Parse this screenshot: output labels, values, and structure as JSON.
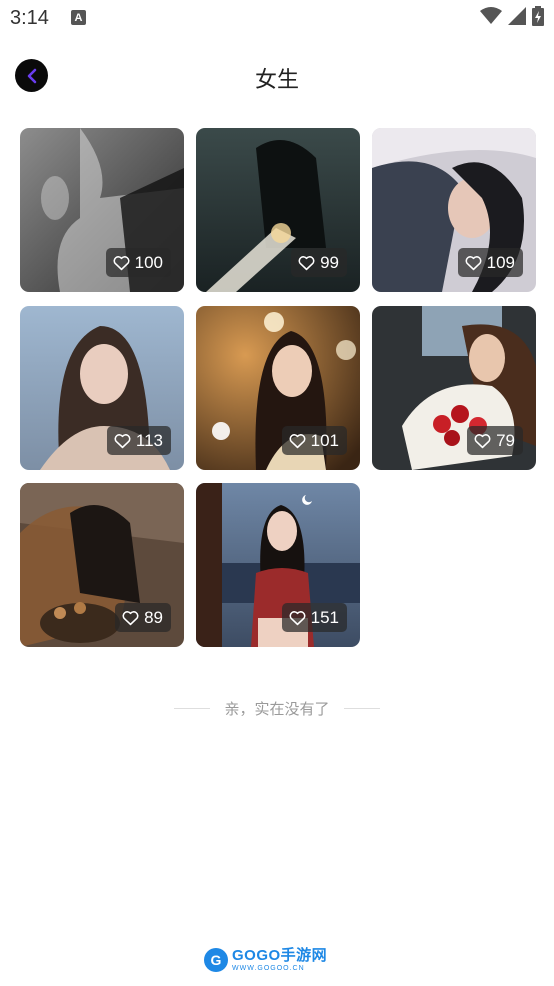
{
  "status_bar": {
    "time": "3:14",
    "app_icon_letter": "A"
  },
  "header": {
    "title": "女生"
  },
  "photos": [
    {
      "likes": "100",
      "theme": "bw"
    },
    {
      "likes": "99",
      "theme": "dark-teal"
    },
    {
      "likes": "109",
      "theme": "bed-grey"
    },
    {
      "likes": "113",
      "theme": "sky-blue"
    },
    {
      "likes": "101",
      "theme": "bokeh-warm"
    },
    {
      "likes": "79",
      "theme": "car-rose"
    },
    {
      "likes": "89",
      "theme": "blur-warm"
    },
    {
      "likes": "151",
      "theme": "dusk-sea"
    }
  ],
  "footer": {
    "end_text": "亲，实在没有了"
  },
  "watermark": {
    "logo_letter": "G",
    "title": "GOGO手游网",
    "url": "WWW.GOGOO.CN"
  },
  "colors": {
    "back_arrow": "#6a3df0",
    "badge_bg": "#2d2d2d",
    "watermark": "#1e88e5"
  }
}
